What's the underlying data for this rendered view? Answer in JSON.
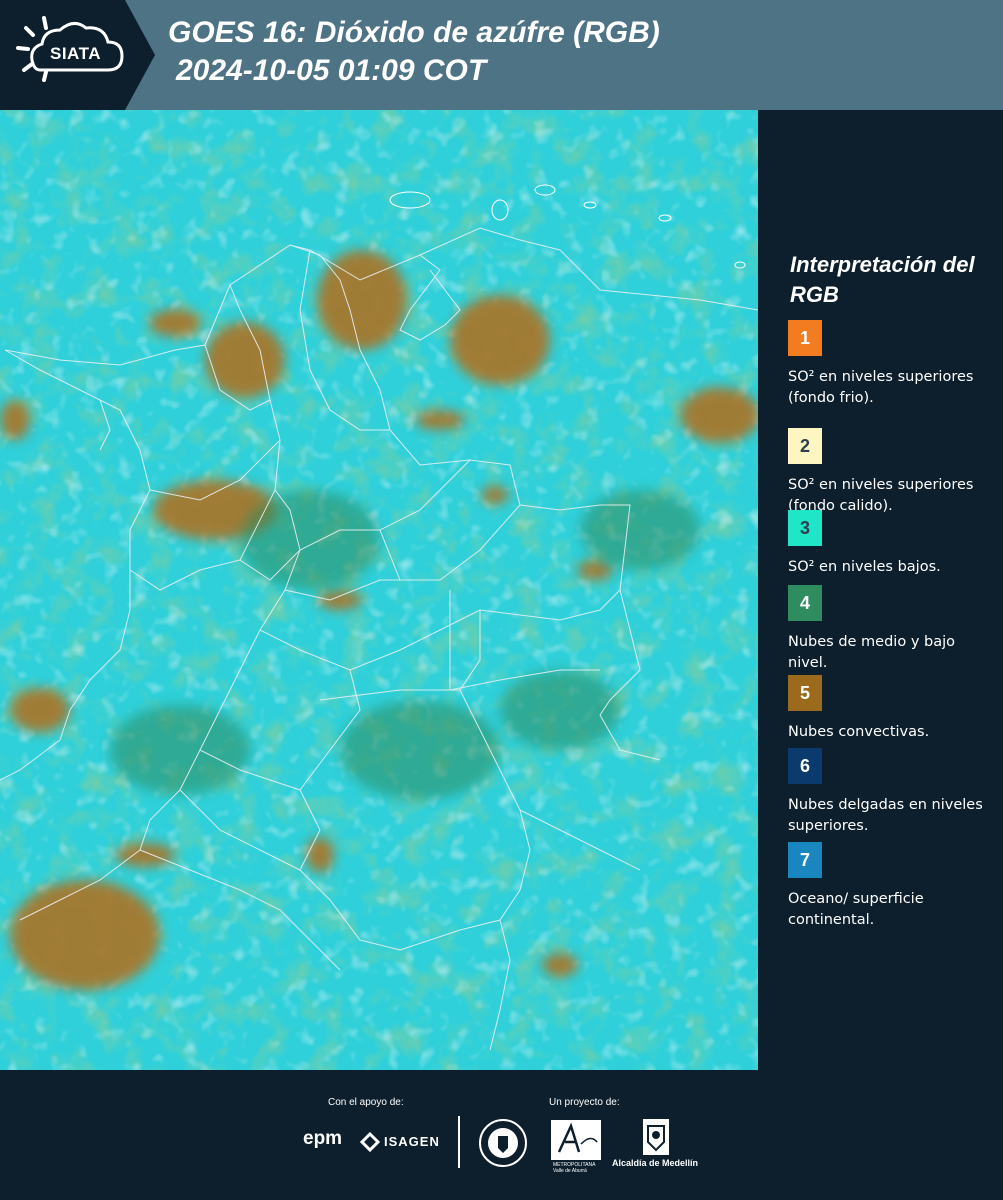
{
  "header": {
    "logo_text": "SIATA",
    "title_line1": "GOES 16: Dióxido de azúfre (RGB)",
    "title_line2": "2024-10-05 01:09 COT"
  },
  "legend": {
    "title": "Interpretación del RGB",
    "items": [
      {
        "number": "1",
        "color": "#f47c20",
        "text_color": "#ffffff",
        "label": "SO² en niveles superiores (fondo frio)."
      },
      {
        "number": "2",
        "color": "#fdf6c2",
        "text_color": "#2c3e50",
        "label": "SO² en niveles superiores (fondo calido)."
      },
      {
        "number": "3",
        "color": "#1ee6c7",
        "text_color": "#2c3e50",
        "label": "SO² en niveles bajos."
      },
      {
        "number": "4",
        "color": "#2e8c5e",
        "text_color": "#ffffff",
        "label": "Nubes de medio y bajo nivel."
      },
      {
        "number": "5",
        "color": "#9b6a1c",
        "text_color": "#ffffff",
        "label": "Nubes convectivas."
      },
      {
        "number": "6",
        "color": "#0a3a6e",
        "text_color": "#ffffff",
        "label": "Nubes delgadas en niveles superiores."
      },
      {
        "number": "7",
        "color": "#1a86c0",
        "text_color": "#ffffff",
        "label": "Oceano/ superficie continental."
      }
    ]
  },
  "map": {
    "ocean_color": "#2fd0da",
    "cloud_mid_color": "#3a9e54",
    "cloud_convective_color": "#a5782e",
    "boundary_color": "#e8f0f2"
  },
  "footer": {
    "support_label": "Con el apoyo de:",
    "project_label": "Un proyecto de:",
    "sponsors": [
      "epm",
      "ISAGEN"
    ],
    "partners": [
      "Área Metropolitana Valle de Aburrá",
      "Alcaldía de Medellín"
    ],
    "epm_text": "epm",
    "isagen_text": "ISAGEN",
    "metro_line1": "METROPOLITANA",
    "metro_line2": "Valle de Aburrá",
    "alcaldia_text": "Alcaldía de Medellín"
  }
}
